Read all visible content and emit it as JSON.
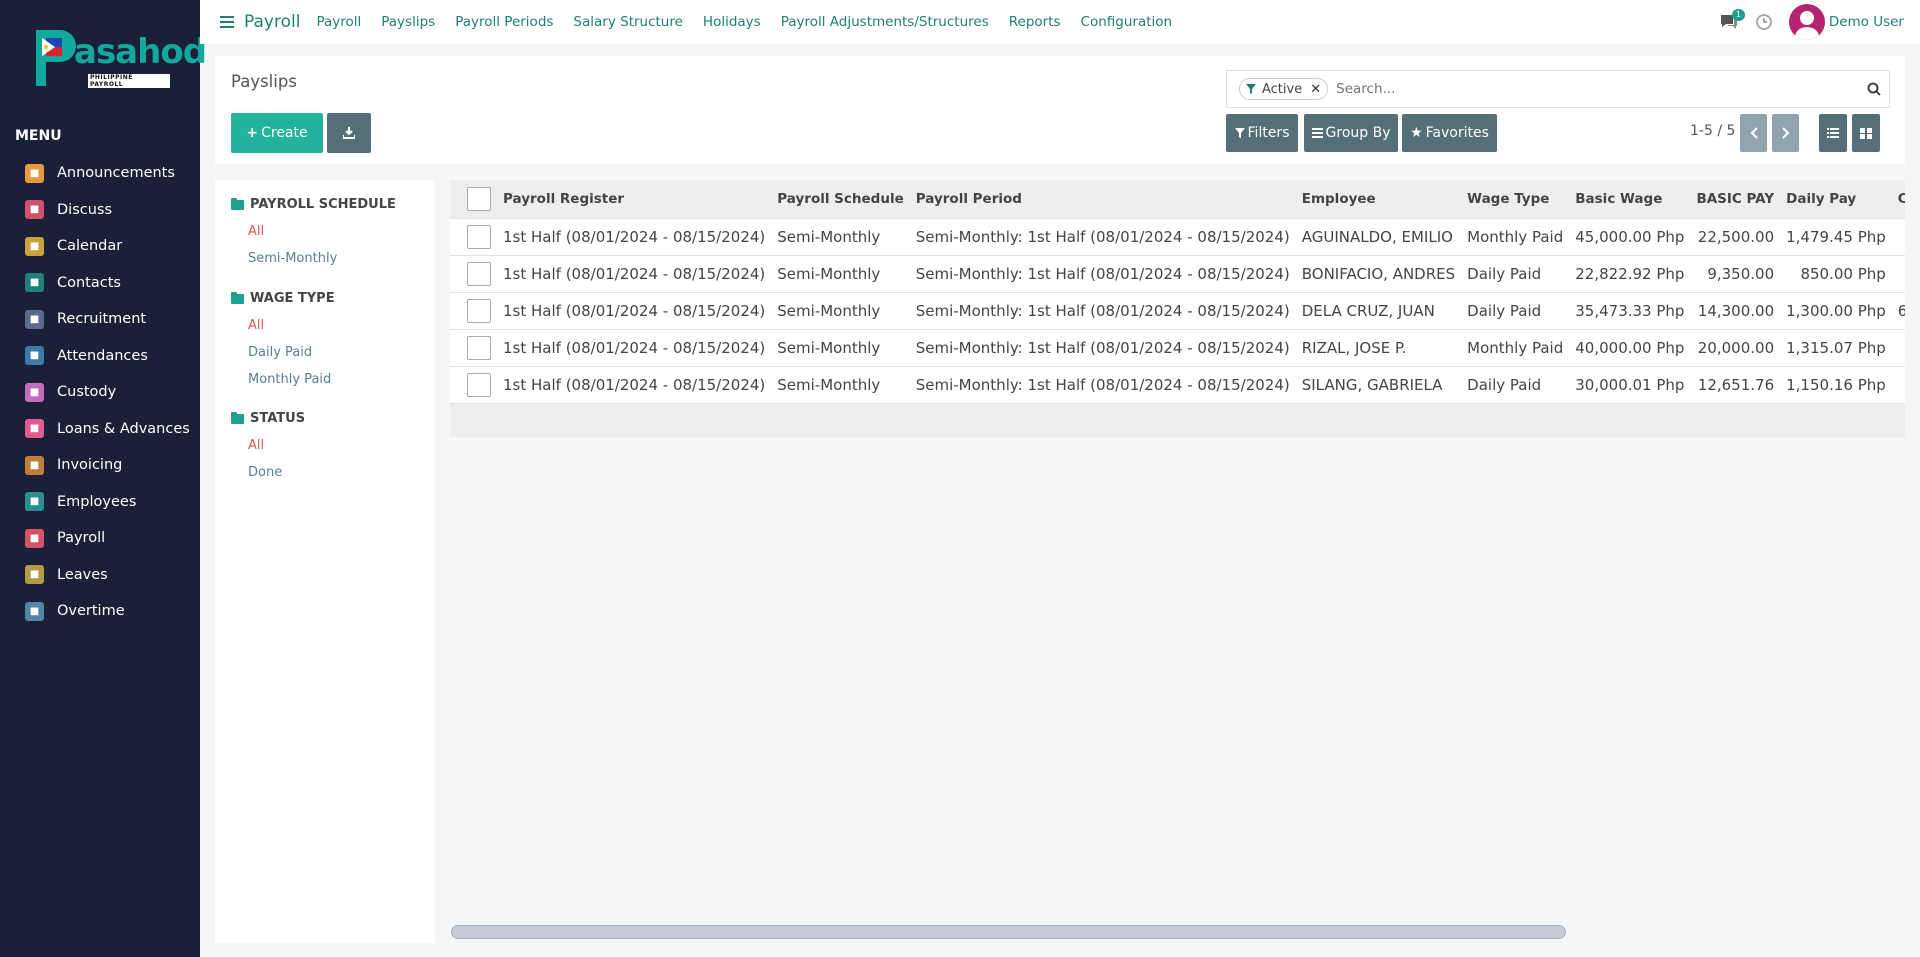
{
  "brand": {
    "logo_text": "asahod",
    "logo_sub": "PHILIPPINE PAYROLL"
  },
  "sidebar": {
    "menu_title": "MENU",
    "items": [
      {
        "label": "Announcements",
        "color": "#e79a3e"
      },
      {
        "label": "Discuss",
        "color": "#d1506e"
      },
      {
        "label": "Calendar",
        "color": "#c9a33e"
      },
      {
        "label": "Contacts",
        "color": "#21807a"
      },
      {
        "label": "Recruitment",
        "color": "#5a6b8c"
      },
      {
        "label": "Attendances",
        "color": "#3a7ca5"
      },
      {
        "label": "Custody",
        "color": "#c76bbd"
      },
      {
        "label": "Loans & Advances",
        "color": "#e35a8f"
      },
      {
        "label": "Invoicing",
        "color": "#c17d3a"
      },
      {
        "label": "Employees",
        "color": "#2a8f91"
      },
      {
        "label": "Payroll",
        "color": "#d5536a"
      },
      {
        "label": "Leaves",
        "color": "#b39c46"
      },
      {
        "label": "Overtime",
        "color": "#4f87a5"
      }
    ]
  },
  "topnav": {
    "app_title": "Payroll",
    "links": [
      "Payroll",
      "Payslips",
      "Payroll Periods",
      "Salary Structure",
      "Holidays",
      "Payroll Adjustments/Structures",
      "Reports",
      "Configuration"
    ],
    "chat_badge": "1",
    "user_name": "Demo User"
  },
  "control": {
    "breadcrumb": "Payslips",
    "create_label": "Create",
    "facet_label": "Active",
    "search_placeholder": "Search...",
    "filters_label": "Filters",
    "group_by_label": "Group By",
    "favorites_label": "Favorites",
    "pager": "1-5 / 5"
  },
  "search_panel": {
    "sections": [
      {
        "title": "PAYROLL SCHEDULE",
        "items": [
          "All",
          "Semi-Monthly"
        ]
      },
      {
        "title": "WAGE TYPE",
        "items": [
          "All",
          "Daily Paid",
          "Monthly Paid"
        ]
      },
      {
        "title": "STATUS",
        "items": [
          "All",
          "Done"
        ]
      }
    ]
  },
  "table": {
    "columns": [
      "Payroll Register",
      "Payroll Schedule",
      "Payroll Period",
      "Employee",
      "Wage Type",
      "Basic Wage",
      "BASIC PAY",
      "Daily Pay",
      "COLA"
    ],
    "rows": [
      [
        "1st Half (08/01/2024 - 08/15/2024)",
        "Semi-Monthly",
        "Semi-Monthly: 1st Half (08/01/2024 - 08/15/2024)",
        "AGUINALDO, EMILIO",
        "Monthly Paid",
        "45,000.00 Php",
        "22,500.00",
        "1,479.45 Php",
        ""
      ],
      [
        "1st Half (08/01/2024 - 08/15/2024)",
        "Semi-Monthly",
        "Semi-Monthly: 1st Half (08/01/2024 - 08/15/2024)",
        "BONIFACIO, ANDRES",
        "Daily Paid",
        "22,822.92 Php",
        "9,350.00",
        "850.00 Php",
        ""
      ],
      [
        "1st Half (08/01/2024 - 08/15/2024)",
        "Semi-Monthly",
        "Semi-Monthly: 1st Half (08/01/2024 - 08/15/2024)",
        "DELA CRUZ, JUAN",
        "Daily Paid",
        "35,473.33 Php",
        "14,300.00",
        "1,300.00 Php",
        "6"
      ],
      [
        "1st Half (08/01/2024 - 08/15/2024)",
        "Semi-Monthly",
        "Semi-Monthly: 1st Half (08/01/2024 - 08/15/2024)",
        "RIZAL, JOSE P.",
        "Monthly Paid",
        "40,000.00 Php",
        "20,000.00",
        "1,315.07 Php",
        ""
      ],
      [
        "1st Half (08/01/2024 - 08/15/2024)",
        "Semi-Monthly",
        "Semi-Monthly: 1st Half (08/01/2024 - 08/15/2024)",
        "SILANG, GABRIELA",
        "Daily Paid",
        "30,000.01 Php",
        "12,651.76",
        "1,150.16 Php",
        ""
      ]
    ]
  }
}
